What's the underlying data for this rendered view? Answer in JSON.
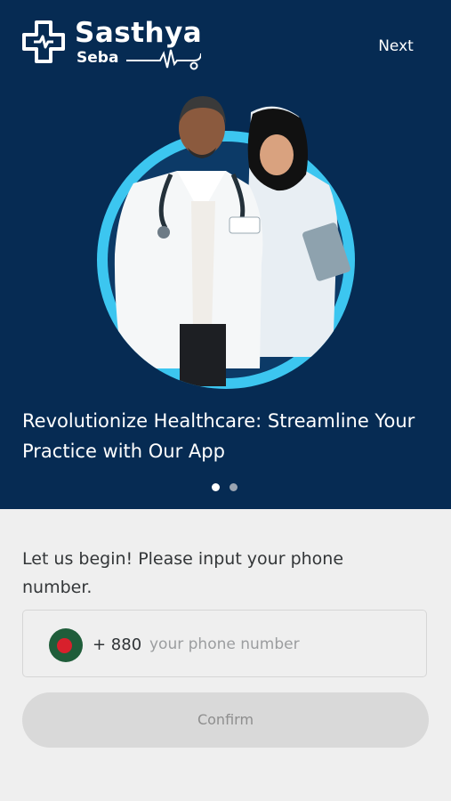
{
  "brand": {
    "name": "Sasthya",
    "subname": "Seba",
    "logo_icon": "medical-cross-icon",
    "pulse_icon": "heartbeat-stethoscope-icon"
  },
  "header": {
    "next_label": "Next"
  },
  "hero": {
    "illustration": "doctors-illustration",
    "headline": "Revolutionize Healthcare: Streamline Your Practice with Our App",
    "pagination": {
      "current": 1,
      "total": 2
    }
  },
  "form": {
    "prompt": "Let us begin! Please input your phone number.",
    "country_flag": "bangladesh-flag-icon",
    "country_code": "+ 880",
    "phone_value": "",
    "phone_placeholder": "your phone number",
    "confirm_label": "Confirm"
  },
  "colors": {
    "hero_background": "#062b53",
    "page_background": "#efefef",
    "accent_circle": "#3cc6f0",
    "button_disabled": "#d9d9d9"
  }
}
